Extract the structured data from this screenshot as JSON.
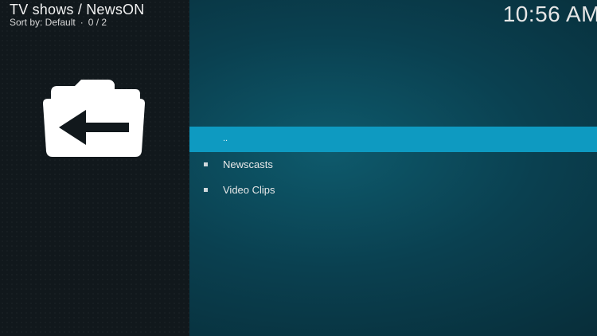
{
  "header": {
    "title": "TV shows / NewsON",
    "sort_label": "Sort by: Default",
    "separator": "·",
    "count": "0 / 2"
  },
  "clock": {
    "time": "10:56 AM"
  },
  "side_panel": {
    "icon": "folder-back-icon"
  },
  "list": {
    "items": [
      {
        "label": "..",
        "focused": true
      },
      {
        "label": "Newscasts",
        "focused": false
      },
      {
        "label": "Video Clips",
        "focused": false
      }
    ]
  },
  "colors": {
    "focus_bar": "#0e9ac1",
    "background": "#0a4050",
    "side_panel": "#11181c"
  }
}
